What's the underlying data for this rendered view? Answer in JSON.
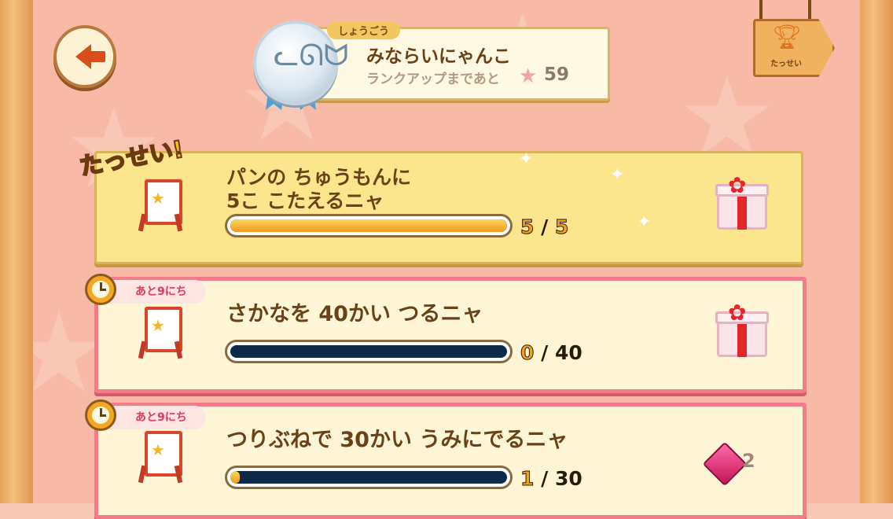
{
  "header": {
    "title_tag": "しょうごう",
    "title_name": "みならいにゃんこ",
    "rank_up_label": "ランクアップまであと",
    "rank_up_count": "59",
    "achievements_label": "たっせい"
  },
  "quests": [
    {
      "status_badge": "たっせい!",
      "line1": "パンの ちゅうもんに",
      "line2": "5こ こたえるニャ",
      "current": "5",
      "target": "5",
      "progress": 1.0,
      "reward": "gift"
    },
    {
      "timer": "あと9にち",
      "line1": "さかなを 40かい つるニャ",
      "current": "0",
      "target": "40",
      "progress": 0.0,
      "reward": "gift"
    },
    {
      "timer": "あと9にち",
      "line1": "つりぶねで 30かい うみにでるニャ",
      "current": "1",
      "target": "30",
      "progress": 0.0333,
      "reward": "gem",
      "reward_count": "2"
    }
  ],
  "colors": {
    "background": "#f8b9a6",
    "frame": "#e8a35a",
    "card_done": "#fbe58d",
    "card_border_pink": "#f17c8a",
    "bar_fill": "#f39a1e",
    "bar_empty": "#0c2a48"
  },
  "icons": {
    "back": "back-arrow-icon",
    "medal": "cat-medal-icon",
    "trophy": "trophy-icon",
    "easel": "easel-star-icon",
    "clock": "clock-icon",
    "gift": "gift-icon",
    "gem": "gem-icon",
    "star": "star-icon"
  }
}
